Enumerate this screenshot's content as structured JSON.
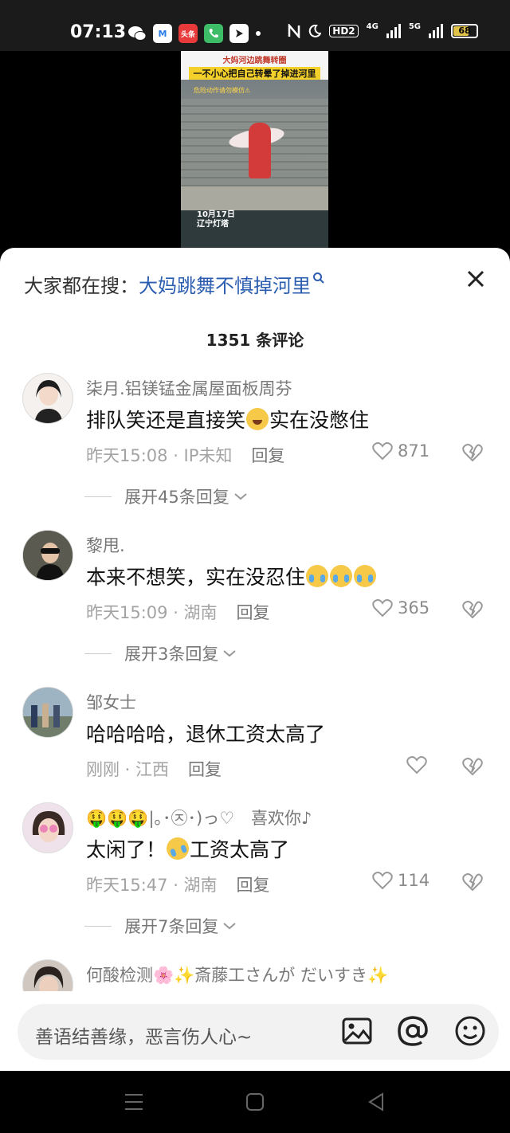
{
  "status_bar": {
    "time": "07:13",
    "app_icons": [
      {
        "name": "wechat-icon",
        "label": "",
        "color": "#2aa745"
      },
      {
        "name": "maps-icon",
        "label": "M",
        "color": "#2b7de9"
      },
      {
        "name": "toutiao-icon",
        "label": "头条",
        "color": "#e83a3a"
      },
      {
        "name": "phone-icon",
        "label": "",
        "color": "#3dbd67"
      },
      {
        "name": "arrow-app-icon",
        "label": "",
        "color": "#222222"
      }
    ],
    "hd_label": "HD2",
    "net_4g": "4G",
    "net_5g": "5G",
    "battery": "68",
    "battery_level": 0.68
  },
  "video": {
    "headline_1": "大妈河边跳舞转圈",
    "headline_2": "一不小心把自己转晕了掉进河里",
    "warning": "危险动作请勿模仿⚠",
    "date": "10月17日",
    "location": "辽宁灯塔"
  },
  "panel": {
    "search_prefix": "大家都在搜：",
    "search_term": "大妈跳舞不慎掉河里",
    "search_mark": "Q",
    "comment_count": "1351 条评论"
  },
  "comments": [
    {
      "name": "柒月.铝镁锰金属屋面板周芬",
      "text": "排队笑还是直接笑",
      "text_after": "实在没憋住",
      "time": "昨天15:08 · IP未知",
      "reply": "回复",
      "likes": "871",
      "expand": "展开45条回复"
    },
    {
      "name": "黎甩.",
      "text": "本来不想笑，实在没忍住",
      "time": "昨天15:09 · 湖南",
      "reply": "回复",
      "likes": "365",
      "expand": "展开3条回复"
    },
    {
      "name": "邹女士",
      "text": "哈哈哈哈，退休工资太高了",
      "time": "刚刚 · 江西",
      "reply": "回复",
      "likes": ""
    },
    {
      "name": "🤑🤑🤑|｡･㉨･)っ♡　喜欢你♪",
      "text": "太闲了！",
      "text_after": "工资太高了",
      "time": "昨天15:47 · 湖南",
      "reply": "回复",
      "likes": "114",
      "expand": "展开7条回复"
    },
    {
      "name": "何酸检测🌸✨斎藤工さんが だいすき✨"
    }
  ],
  "input": {
    "placeholder": "善语结善缘，恶言伤人心~"
  },
  "colors": {
    "link_blue": "#2a5db0",
    "meta_gray": "#a3a3a3",
    "battery_yellow": "#e2c34a"
  }
}
